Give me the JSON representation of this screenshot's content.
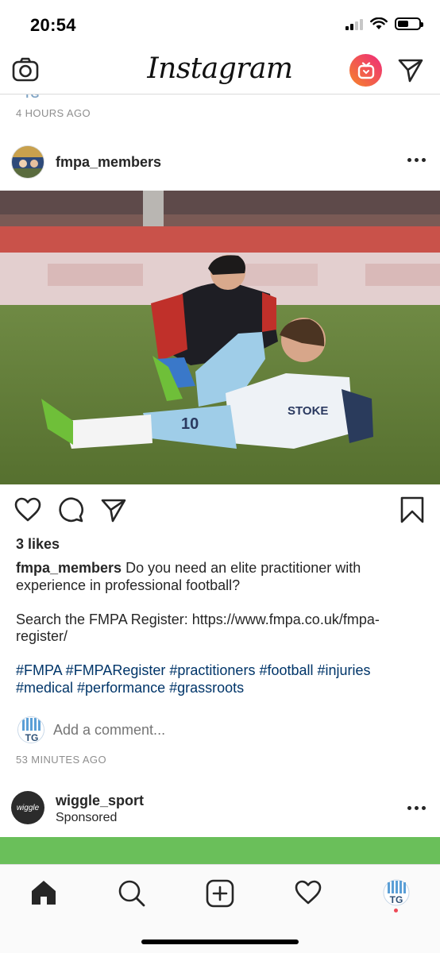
{
  "status_bar": {
    "time": "20:54",
    "battery_level": 0.5
  },
  "top_nav": {
    "logo_text": "Instagram",
    "igtv_color": "#f58529"
  },
  "feed": {
    "previous_post": {
      "time": "4 HOURS AGO"
    },
    "post": {
      "username": "fmpa_members",
      "likes": "3 likes",
      "caption_user": "fmpa_members",
      "caption_text": "Do you need an elite practitioner with experience in professional football?",
      "caption_paragraph2": "Search the FMPA Register: https://www.fmpa.co.uk/fmpa-register/",
      "hashtags": "#FMPA #FMPARegister #practitioners #football #injuries #medical #performance #grassroots",
      "comment_placeholder": "Add a comment...",
      "time": "53 MINUTES AGO",
      "hashtag_color": "#003569"
    },
    "next_post": {
      "username": "wiggle_sport",
      "label": "Sponsored",
      "avatar_text": "wiggle",
      "media_color": "#6abf5a"
    }
  },
  "user_avatar": {
    "initials": "TG"
  },
  "tab_bar": {
    "items": [
      "home-icon",
      "search-icon",
      "new-post-icon",
      "activity-heart-icon",
      "profile-avatar"
    ],
    "notification_color": "#ed4956"
  }
}
